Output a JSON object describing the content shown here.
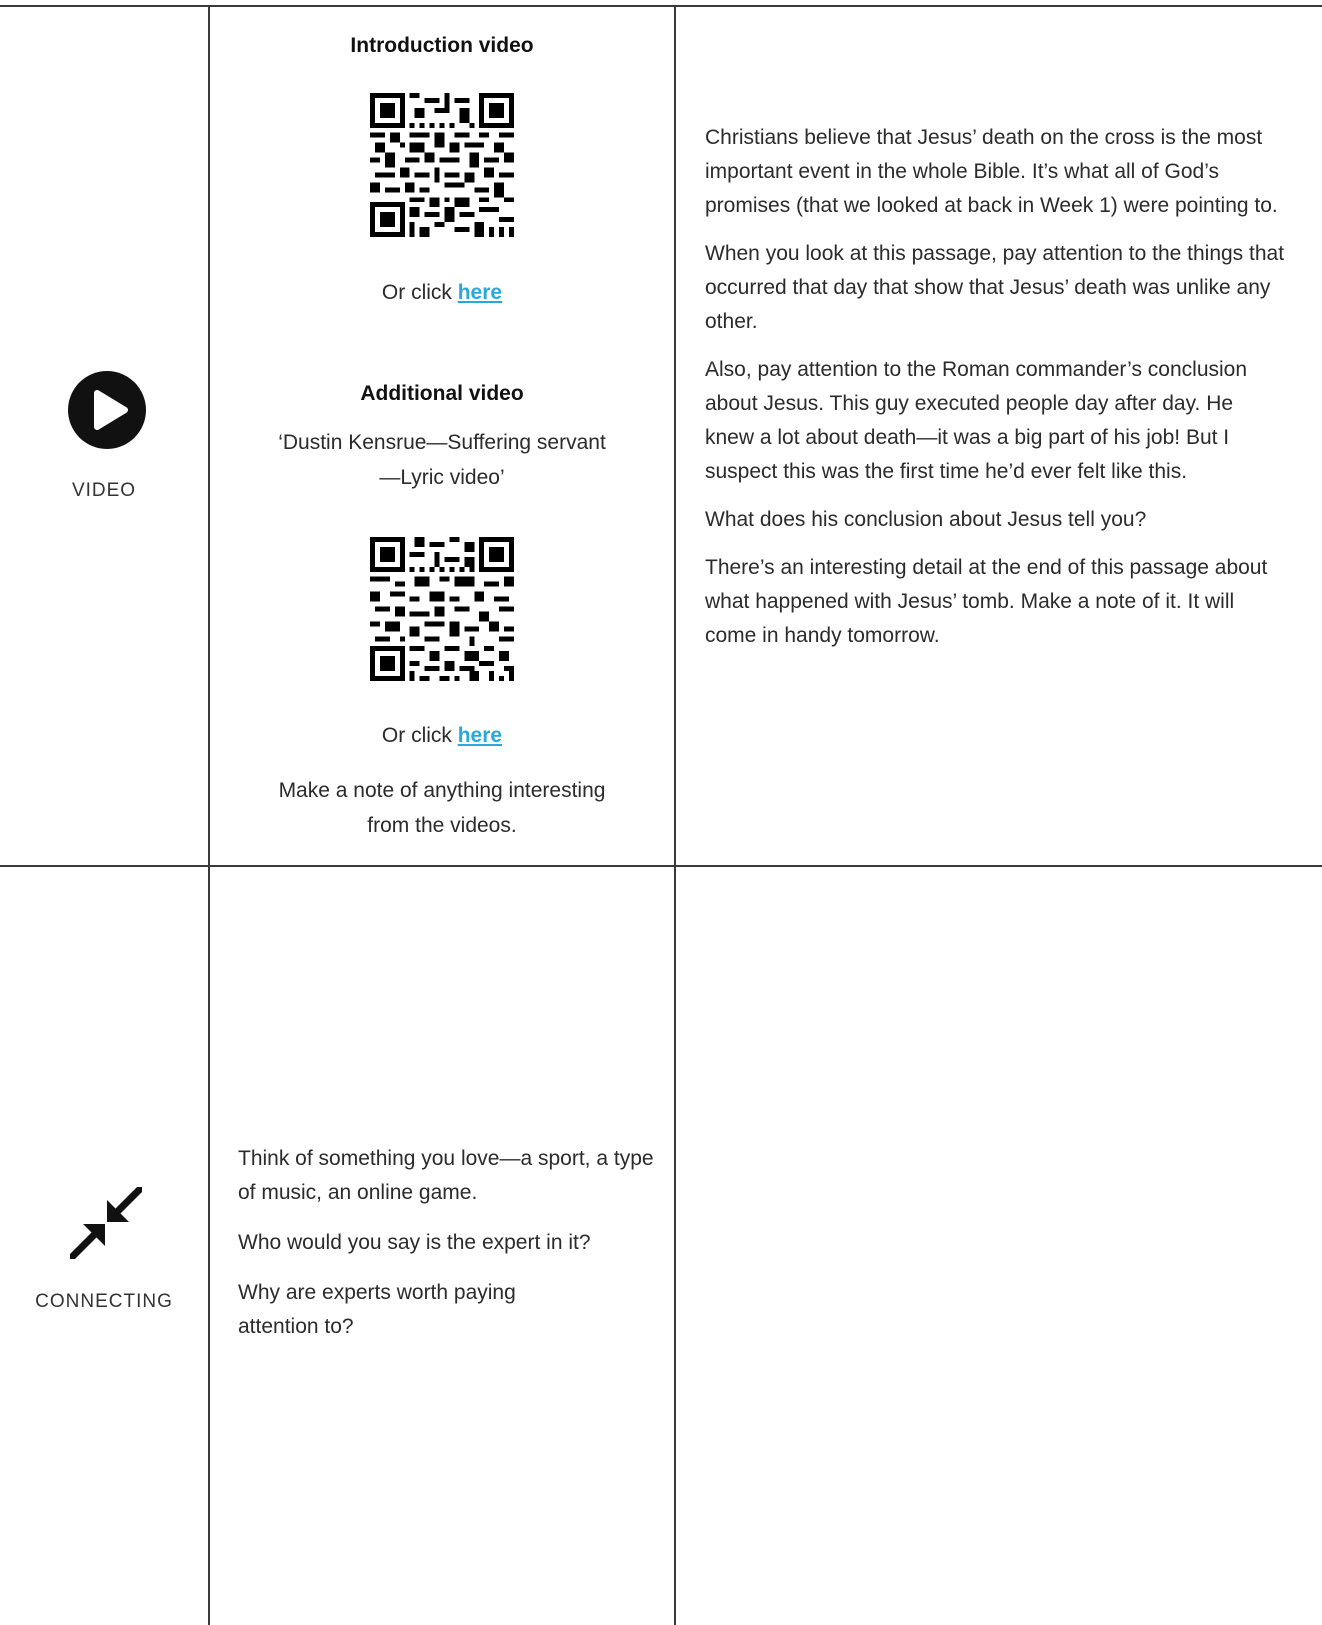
{
  "rows": {
    "video": {
      "label": "VIDEO",
      "icon": "play-circle-icon",
      "middle": {
        "intro_heading": "Introduction video",
        "or_click": "Or click ",
        "link_text": "here",
        "additional_heading": "Additional video",
        "additional_title_line1": "‘Dustin Kensrue—Suffering servant",
        "additional_title_line2": "—Lyric video’",
        "note_line1": "Make a note of anything interesting",
        "note_line2": "from the videos."
      },
      "right": [
        "Christians believe that Jesus’ death on the cross is the most important event in the whole Bible. It’s what all of God’s promises (that we looked at back in Week 1) were pointing to.",
        "When you look at this passage, pay attention to the things that occurred that day that show that Jesus’ death was unlike any other.",
        "Also, pay attention to the Roman commander’s conclusion about Jesus. This guy executed people day after day. He knew a lot about death—it was a big part of his job! But I suspect this was the first time he’d ever felt like this.",
        "What does his conclusion about Jesus tell you?",
        "There’s an interesting detail at the end of this passage about what happened with Jesus’ tomb. Make a note of it. It will come in handy tomorrow."
      ]
    },
    "connecting": {
      "label": "CONNECTING",
      "icon": "arrows-converge-icon",
      "middle": [
        "Think of something you love—a sport, a type of music, an online game.",
        "Who would you say is the expert in it?",
        "Why are experts worth paying attention to?"
      ]
    }
  },
  "colors": {
    "link": "#2aa8dc",
    "rule": "#3a3a3a",
    "text": "#2b2b2b"
  }
}
